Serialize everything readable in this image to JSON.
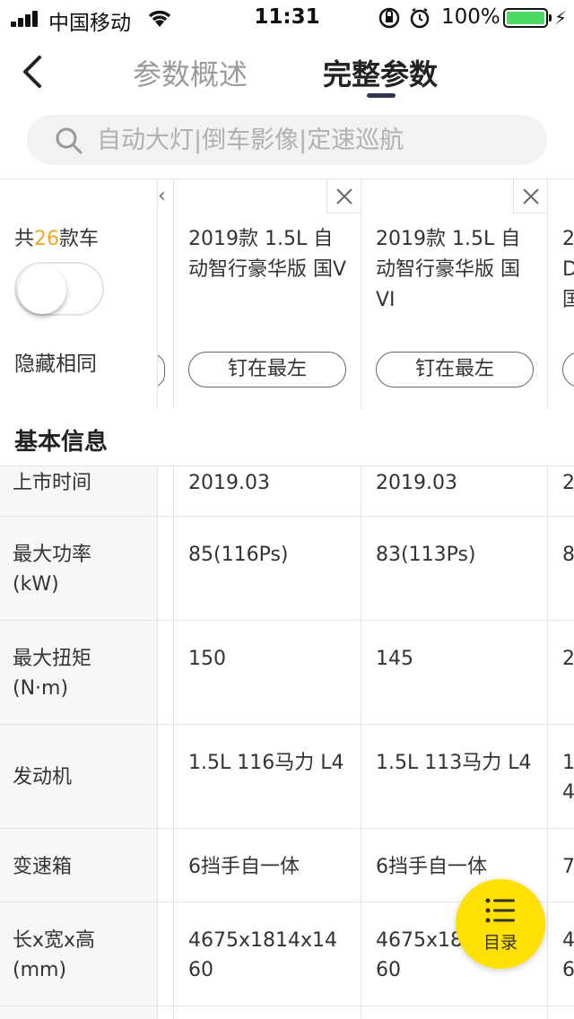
{
  "status_bar": {
    "carrier": "中国移动",
    "time": "11:31",
    "battery": "100%",
    "icons": [
      "signal-icon",
      "wifi-icon",
      "rotation-lock-icon",
      "alarm-icon",
      "battery-icon",
      "charging-icon"
    ]
  },
  "nav": {
    "tabs": [
      {
        "label": "参数概述",
        "active": false
      },
      {
        "label": "完整参数",
        "active": true
      }
    ],
    "icons": [
      "back-icon"
    ]
  },
  "search": {
    "placeholder": "自动大灯|倒车影像|定速巡航",
    "value": ""
  },
  "header": {
    "count_prefix": "共",
    "count": "26",
    "count_suffix": "款车",
    "hide_same_label": "隐藏相同",
    "hide_same_on": false
  },
  "cars": [
    {
      "name": "2019款 1.5L 自动智行豪华版 国V",
      "pin_label": "钉在最左"
    },
    {
      "name": "2019款 1.5L 自动智行豪华版 国VI",
      "pin_label": "钉在最左"
    },
    {
      "name": "2\nD\n国"
    }
  ],
  "section": {
    "title": "基本信息"
  },
  "rows": [
    {
      "label": "上市时间",
      "values": [
        "2019.03",
        "2019.03",
        "2"
      ]
    },
    {
      "label": "最大功率\n(kW)",
      "values": [
        "85(116Ps)",
        "83(113Ps)",
        "8"
      ]
    },
    {
      "label": "最大扭矩\n(N·m)",
      "values": [
        "150",
        "145",
        "2"
      ]
    },
    {
      "label": "发动机",
      "values": [
        "1.5L 116马力 L4",
        "1.5L 113马力 L4",
        "1.\n4"
      ]
    },
    {
      "label": "变速箱",
      "values": [
        "6挡手自一体",
        "6挡手自一体",
        "7"
      ]
    },
    {
      "label": "长x宽x高\n(mm)",
      "values": [
        "4675x1814x1460",
        "4675x1814x1460",
        "4\n6"
      ]
    }
  ],
  "fab": {
    "label": "目录",
    "icon": "list-icon"
  },
  "colors": {
    "accent": "#f5a623",
    "fab": "#ffe000",
    "battery": "#4cd964",
    "nav_indicator": "#2e3550"
  }
}
